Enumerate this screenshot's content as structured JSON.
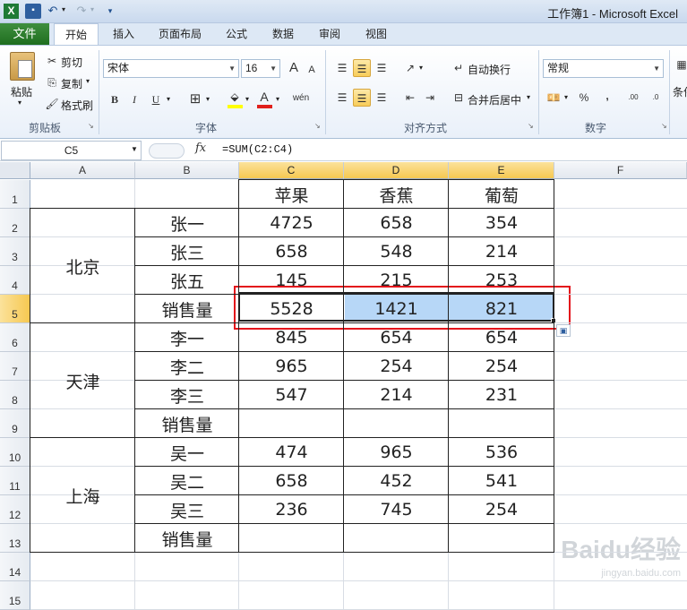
{
  "app": {
    "title": "工作簿1 - Microsoft Excel",
    "qat": [
      "save-icon",
      "undo-icon",
      "redo-icon",
      "customize-icon"
    ]
  },
  "tabs": [
    "文件",
    "开始",
    "插入",
    "页面布局",
    "公式",
    "数据",
    "审阅",
    "视图"
  ],
  "ribbon": {
    "clipboard": {
      "label": "剪贴板",
      "paste": "粘贴",
      "cut": "剪切",
      "copy": "复制",
      "format_painter": "格式刷"
    },
    "font": {
      "label": "字体",
      "name": "宋体",
      "size": "16",
      "bold": "B",
      "italic": "I",
      "underline": "U",
      "grow": "A",
      "shrink": "A"
    },
    "alignment": {
      "label": "对齐方式",
      "wrap": "自动换行",
      "merge": "合并后居中"
    },
    "number": {
      "label": "数字",
      "format": "常规",
      "percent": "%",
      "comma": ","
    },
    "styles": {
      "label": "条件"
    }
  },
  "formula_bar": {
    "name_box": "C5",
    "fx": "fx",
    "formula": "=SUM(C2:C4)"
  },
  "sheet": {
    "columns": [
      "A",
      "B",
      "C",
      "D",
      "E",
      "F"
    ],
    "rows": [
      "1",
      "2",
      "3",
      "4",
      "5",
      "6",
      "7",
      "8",
      "9",
      "10",
      "11",
      "12",
      "13",
      "14",
      "15"
    ],
    "header_row": [
      "苹果",
      "香蕉",
      "葡萄"
    ],
    "groups": [
      {
        "city": "北京",
        "rows": [
          {
            "name": "张一",
            "c": "4725",
            "d": "658",
            "e": "354"
          },
          {
            "name": "张三",
            "c": "658",
            "d": "548",
            "e": "214"
          },
          {
            "name": "张五",
            "c": "145",
            "d": "215",
            "e": "253"
          },
          {
            "name": "销售量",
            "c": "5528",
            "d": "1421",
            "e": "821"
          }
        ]
      },
      {
        "city": "天津",
        "rows": [
          {
            "name": "李一",
            "c": "845",
            "d": "654",
            "e": "654"
          },
          {
            "name": "李二",
            "c": "965",
            "d": "254",
            "e": "254"
          },
          {
            "name": "李三",
            "c": "547",
            "d": "214",
            "e": "231"
          },
          {
            "name": "销售量",
            "c": "",
            "d": "",
            "e": ""
          }
        ]
      },
      {
        "city": "上海",
        "rows": [
          {
            "name": "吴一",
            "c": "474",
            "d": "965",
            "e": "536"
          },
          {
            "name": "吴二",
            "c": "658",
            "d": "452",
            "e": "541"
          },
          {
            "name": "吴三",
            "c": "236",
            "d": "745",
            "e": "254"
          },
          {
            "name": "销售量",
            "c": "",
            "d": "",
            "e": ""
          }
        ]
      }
    ],
    "active_cell": "C5",
    "selection": "C5:E5",
    "highlight_color": "#e3131b",
    "selection_fill": "#b7d7f7"
  },
  "watermark": {
    "brand": "Baidu经验",
    "url": "jingyan.baidu.com"
  }
}
